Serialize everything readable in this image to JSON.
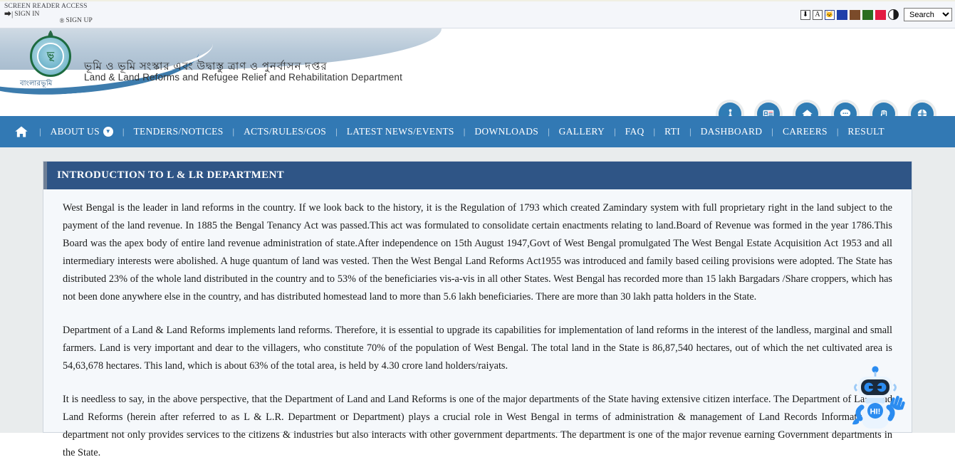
{
  "topbar": {
    "screen_reader_label": "SCREEN READER ACCESS",
    "sign_in_label": "SIGN IN",
    "sign_up_label": "SIGN UP",
    "sign_in_icon": "login-arrow-icon",
    "sign_up_icon": "register-circle-icon",
    "accessibility": {
      "download_label": "A",
      "font_size_label": "A",
      "theme_icon_label": "theme",
      "contrast_label": "contrast"
    },
    "swatches": [
      {
        "name": "swatch-blue",
        "color": "#1f3faa"
      },
      {
        "name": "swatch-brown",
        "color": "#7b4b2a"
      },
      {
        "name": "swatch-green",
        "color": "#2a6e20"
      },
      {
        "name": "swatch-red",
        "color": "#e31b42"
      }
    ],
    "search": {
      "selected": "Search",
      "options": [
        "Search"
      ]
    }
  },
  "banner": {
    "title_bn": "ভূমি ও ভূমি সংস্কার এবং উদ্বাস্তু ত্রাণ ও পুনর্বাসন দপ্তর",
    "title_en": "Land & Land Reforms and Refugee Relief and Rehabilitation Department",
    "logo_word": "বাংলারভূমি",
    "emblem_text": "ভূ"
  },
  "quick_links": [
    {
      "name": "quick-link-download",
      "icon": "download-person-icon"
    },
    {
      "name": "quick-link-idcard",
      "icon": "id-card-icon"
    },
    {
      "name": "quick-link-home",
      "icon": "home-icon"
    },
    {
      "name": "quick-link-feedback",
      "icon": "chat-bubble-icon"
    },
    {
      "name": "quick-link-hand",
      "icon": "hand-icon"
    },
    {
      "name": "quick-link-globe",
      "icon": "globe-icon"
    }
  ],
  "nav": {
    "home_icon": "home-icon",
    "separator": "|",
    "items": [
      {
        "label": "ABOUT US",
        "has_caret": true
      },
      {
        "label": "TENDERS/NOTICES",
        "has_caret": false
      },
      {
        "label": "ACTS/RULES/GOS",
        "has_caret": false
      },
      {
        "label": "LATEST NEWS/EVENTS",
        "has_caret": false
      },
      {
        "label": "DOWNLOADS",
        "has_caret": false
      },
      {
        "label": "GALLERY",
        "has_caret": false
      },
      {
        "label": "FAQ",
        "has_caret": false
      },
      {
        "label": "RTI",
        "has_caret": false
      },
      {
        "label": "DASHBOARD",
        "has_caret": false
      },
      {
        "label": "CAREERS",
        "has_caret": false
      },
      {
        "label": "RESULT",
        "has_caret": false
      }
    ]
  },
  "panel": {
    "heading": "INTRODUCTION TO L & LR DEPARTMENT",
    "paragraphs": [
      "West Bengal is the leader in land reforms in the country. If we look back to the history, it is the Regulation of 1793 which created Zamindary system with full proprietary right in the land subject to the payment of the land revenue. In 1885 the Bengal Tenancy Act was passed.This act was formulated to consolidate certain enactments relating to land.Board of Revenue was formed in the year 1786.This Board was the apex body of entire land revenue administration of state.After independence on 15th August 1947,Govt of West Bengal promulgated The West Bengal Estate Acquisition Act 1953 and all intermediary interests were abolished. A huge quantum of land was vested. Then the West Bengal Land Reforms Act1955 was introduced and family based ceiling provisions were adopted. The State has distributed 23% of the whole land distributed in the country and to 53% of the beneficiaries vis-a-vis in all other States. West Bengal has recorded more than 15 lakh Bargadars /Share croppers, which has not been done anywhere else in the country, and has distributed homestead land to more than 5.6 lakh beneficiaries. There are more than 30 lakh patta holders in the State.",
      "Department of a Land & Land Reforms implements land reforms. Therefore, it is essential to upgrade its capabilities for implementation of land reforms in the interest of the landless, marginal and small farmers. Land is very important and dear to the villagers, who constitute 70% of the population of West Bengal. The total land in the State is 86,87,540 hectares, out of which the net cultivated area is 54,63,678 hectares. This land, which is about 63% of the total area, is held by 4.30 crore land holders/raiyats.",
      "It is needless to say, in the above perspective, that the Department of Land and Land Reforms is one of the major departments of the State having extensive citizen interface. The Department of Land and Land Reforms (herein after referred to as L & L.R. Department or Department) plays a crucial role in West Bengal in terms of administration & management of Land Records Information. The department not only provides services to the citizens & industries but also interacts with other government departments. The department is one of the major revenue earning Government departments in the State."
    ]
  },
  "chatbot": {
    "badge_text": "HI!",
    "name": "chatbot-mascot"
  },
  "colors": {
    "nav_blue": "#3279b4",
    "panel_head_blue": "#2f5586",
    "page_gray": "#e9eced",
    "icon_blue": "#2f7cb5",
    "bot_blue": "#2b8cf0"
  }
}
